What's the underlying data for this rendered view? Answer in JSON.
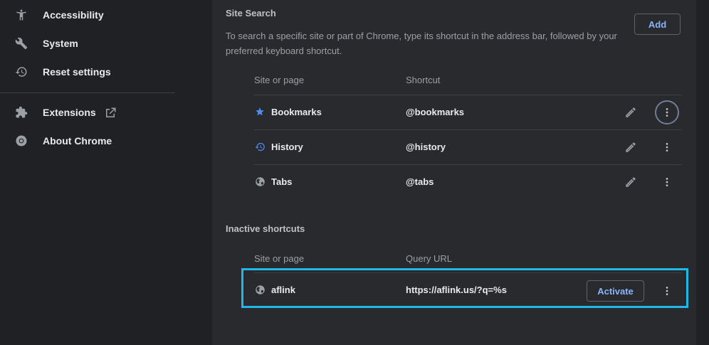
{
  "sidebar": {
    "items": [
      {
        "label": "Accessibility",
        "icon": "accessibility-icon"
      },
      {
        "label": "System",
        "icon": "wrench-icon"
      },
      {
        "label": "Reset settings",
        "icon": "reset-history-icon"
      },
      {
        "label": "Extensions",
        "icon": "puzzle-icon"
      },
      {
        "label": "About Chrome",
        "icon": "chrome-icon"
      }
    ]
  },
  "site_search": {
    "title": "Site Search",
    "description": "To search a specific site or part of Chrome, type its shortcut in the address bar, followed by your preferred keyboard shortcut.",
    "add_label": "Add",
    "col_site": "Site or page",
    "col_shortcut": "Shortcut",
    "rows": [
      {
        "name": "Bookmarks",
        "shortcut": "@bookmarks",
        "icon": "star-icon"
      },
      {
        "name": "History",
        "shortcut": "@history",
        "icon": "history-icon"
      },
      {
        "name": "Tabs",
        "shortcut": "@tabs",
        "icon": "globe-icon"
      }
    ]
  },
  "inactive": {
    "title": "Inactive shortcuts",
    "col_site": "Site or page",
    "col_url": "Query URL",
    "rows": [
      {
        "name": "aflink",
        "url": "https://aflink.us/?q=%s",
        "activate_label": "Activate",
        "icon": "globe-icon"
      }
    ]
  },
  "colors": {
    "accent": "#8ab4f8",
    "highlight": "#1fb8e8",
    "background": "#202124",
    "card": "#292a2d"
  }
}
